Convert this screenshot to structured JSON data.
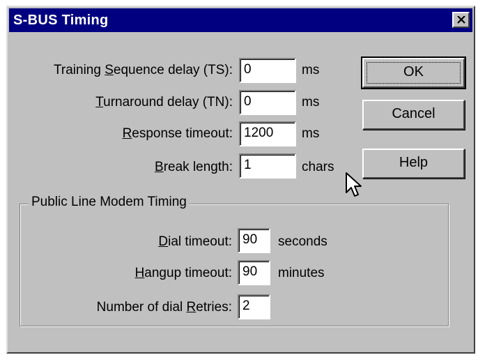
{
  "window": {
    "title": "S-BUS Timing"
  },
  "fields": [
    {
      "pre": "Training ",
      "acc": "S",
      "post": "equence delay (TS):",
      "value": "0",
      "unit": "ms"
    },
    {
      "pre": "",
      "acc": "T",
      "post": "urnaround delay (TN):",
      "value": "0",
      "unit": "ms"
    },
    {
      "pre": "",
      "acc": "R",
      "post": "esponse timeout:",
      "value": "1200",
      "unit": "ms"
    },
    {
      "pre": "",
      "acc": "B",
      "post": "reak length:",
      "value": "1",
      "unit": "chars"
    }
  ],
  "buttons": {
    "ok": "OK",
    "cancel": "Cancel",
    "help": "Help"
  },
  "modem_group": {
    "title": "Public Line Modem Timing",
    "fields": [
      {
        "pre": "",
        "acc": "D",
        "post": "ial timeout:",
        "value": "90",
        "unit": "seconds"
      },
      {
        "pre": "",
        "acc": "H",
        "post": "angup timeout:",
        "value": "90",
        "unit": "minutes"
      },
      {
        "pre": "Number of dial ",
        "acc": "R",
        "post": "etries:",
        "value": "2",
        "unit": ""
      }
    ]
  },
  "colors": {
    "titlebar": "#000080",
    "face": "#c0c0c0"
  },
  "icons": {
    "close": "close-icon",
    "cursor": "mouse-pointer-icon"
  }
}
